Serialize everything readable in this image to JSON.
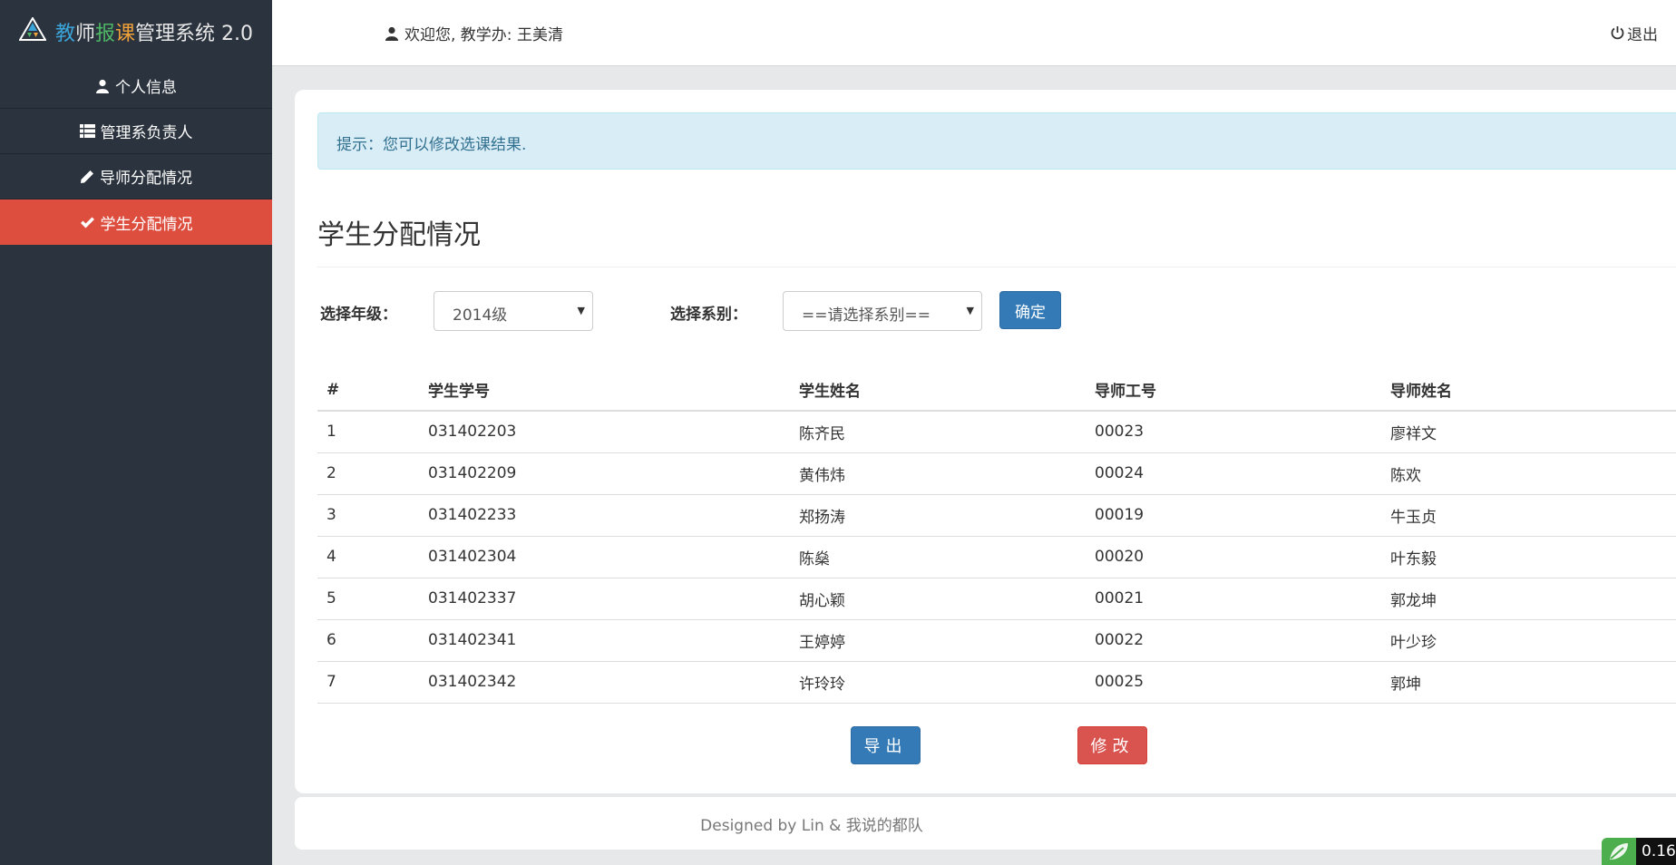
{
  "sidebar": {
    "brand": {
      "part1": "教",
      "part2": "师",
      "part3": "报",
      "part4": "课",
      "rest": "管理系统 2.0"
    },
    "items": [
      {
        "label": "个人信息",
        "icon": "user-icon"
      },
      {
        "label": "管理系负责人",
        "icon": "list-icon"
      },
      {
        "label": "导师分配情况",
        "icon": "pencil-icon"
      },
      {
        "label": "学生分配情况",
        "icon": "check-icon",
        "active": true
      }
    ]
  },
  "header": {
    "welcome": "欢迎您, 教学办: 王美清",
    "logout": "退出"
  },
  "main": {
    "alert": "提示：您可以修改选课结果.",
    "title": "学生分配情况",
    "filters": {
      "grade_label": "选择年级：",
      "grade_value": "2014级",
      "dept_label": "选择系别：",
      "dept_value": "==请选择系别==",
      "confirm": "确定"
    },
    "table": {
      "headers": [
        "#",
        "学生学号",
        "学生姓名",
        "导师工号",
        "导师姓名"
      ],
      "rows": [
        [
          "1",
          "031402203",
          "陈齐民",
          "00023",
          "廖祥文"
        ],
        [
          "2",
          "031402209",
          "黄伟炜",
          "00024",
          "陈欢"
        ],
        [
          "3",
          "031402233",
          "郑扬涛",
          "00019",
          "牛玉贞"
        ],
        [
          "4",
          "031402304",
          "陈燊",
          "00020",
          "叶东毅"
        ],
        [
          "5",
          "031402337",
          "胡心颖",
          "00021",
          "郭龙坤"
        ],
        [
          "6",
          "031402341",
          "王婷婷",
          "00022",
          "叶少珍"
        ],
        [
          "7",
          "031402342",
          "许玲玲",
          "00025",
          "郭坤"
        ]
      ]
    },
    "buttons": {
      "export": "导出",
      "edit": "修改"
    }
  },
  "footer": {
    "text": "Designed by Lin & 我说的都队"
  },
  "widget": {
    "value": "0.16"
  },
  "colors": {
    "sidebar": "#2b333e",
    "active": "#dd4e3f",
    "primary": "#337ab7",
    "danger": "#d9534f",
    "alert_bg": "#d9edf7"
  }
}
